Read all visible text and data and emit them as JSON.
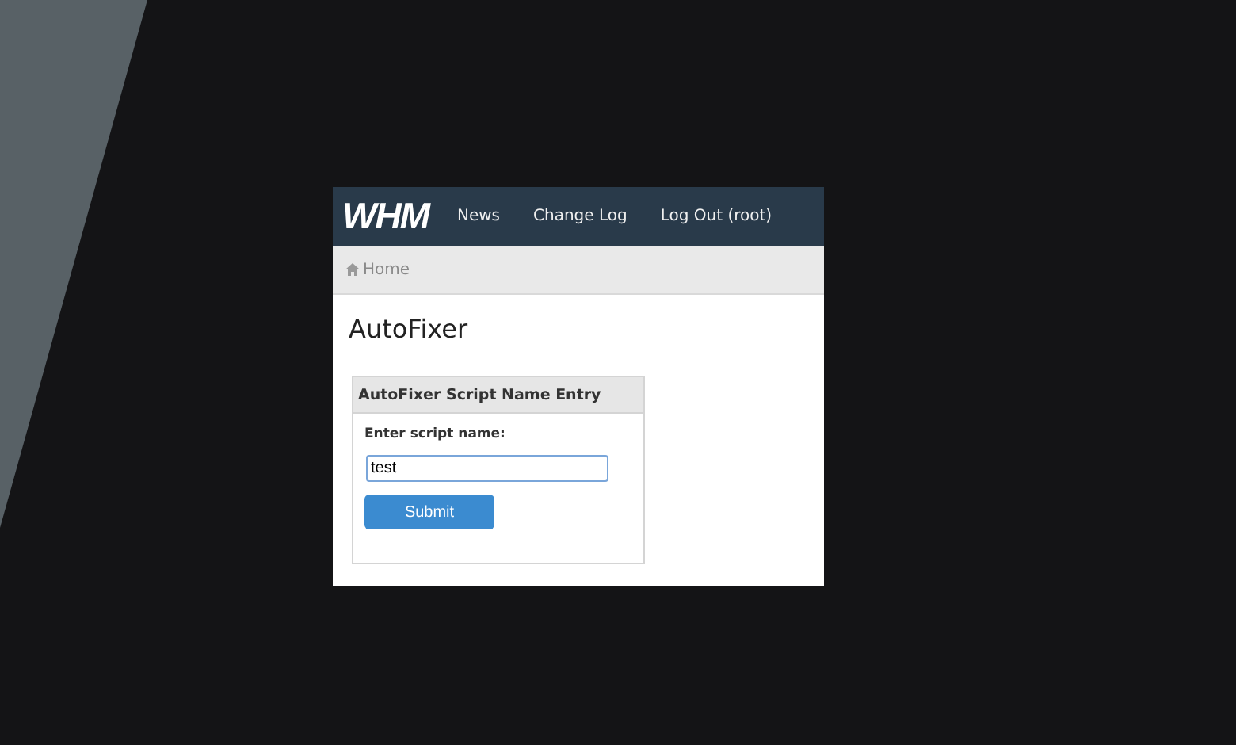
{
  "header": {
    "logo": "WHM",
    "nav": [
      "News",
      "Change Log",
      "Log Out (root)"
    ]
  },
  "breadcrumb": {
    "items": [
      "Home"
    ]
  },
  "page_title": "AutoFixer",
  "panel": {
    "title": "AutoFixer Script Name Entry",
    "field_label": "Enter script name:",
    "field_value": "test",
    "submit": "Submit"
  }
}
